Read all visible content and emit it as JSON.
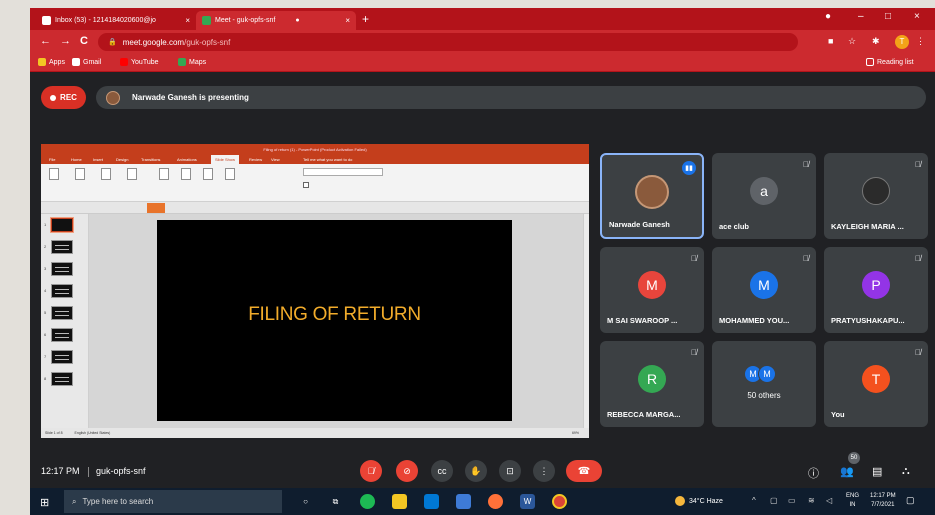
{
  "browser": {
    "tabs": [
      {
        "title": "Inbox (53) - 1214184020600@jo",
        "close": "×"
      },
      {
        "title": "Meet - guk-opfs-snf",
        "close": "×"
      }
    ],
    "new_tab": "+",
    "window_controls": {
      "minimize": "–",
      "maximize": "□",
      "close": "×"
    },
    "nav": {
      "back": "←",
      "forward": "→",
      "reload": "C"
    },
    "url_host": "meet.google.com",
    "url_path": "/guk-opfs-snf",
    "bookmarks": [
      {
        "label": "Apps",
        "color": "#f3c623"
      },
      {
        "label": "Gmail",
        "color": "#ffffff"
      },
      {
        "label": "YouTube",
        "color": "#ff0000"
      },
      {
        "label": "Maps",
        "color": "#34a853"
      }
    ],
    "reading_list": "Reading list",
    "profile_initial": "T"
  },
  "meeting": {
    "rec_label": "REC",
    "presenting_text": "Narwade Ganesh is presenting",
    "time": "12:17 PM",
    "code": "guk-opfs-snf",
    "people_count": "50"
  },
  "presentation": {
    "app_title": "Filing of return (1) - PowerPoint (Product Activation Failed)",
    "menu": [
      "File",
      "Home",
      "Insert",
      "Design",
      "Transitions",
      "Animations",
      "Slide Show",
      "Review",
      "View",
      "Tell me what you want to do"
    ],
    "slide_title": "FILING OF RETURN",
    "slide_count": "Slide 1 of 8",
    "status_language": "English (United States)",
    "zoom": "69%"
  },
  "participants": [
    {
      "name": "Narwade Ganesh",
      "initial": "",
      "color": "#8a5a3c",
      "speaking": true
    },
    {
      "name": "ace club",
      "initial": "a",
      "color": "#5f6368"
    },
    {
      "name": "KAYLEIGH MARIA ...",
      "initial": "",
      "color": "#2b2b2b"
    },
    {
      "name": "M SAI SWAROOP ...",
      "initial": "M",
      "color": "#e8453c"
    },
    {
      "name": "MOHAMMED YOU...",
      "initial": "M",
      "color": "#1a73e8"
    },
    {
      "name": "PRATYUSHAKAPU...",
      "initial": "P",
      "color": "#9334e6"
    },
    {
      "name": "REBECCA MARGA...",
      "initial": "R",
      "color": "#34a853"
    },
    {
      "name": "50 others",
      "initial": "M",
      "color": "#1a73e8"
    },
    {
      "name": "You",
      "initial": "T",
      "color": "#f4511e"
    }
  ],
  "taskbar": {
    "search_placeholder": "Type here to search",
    "weather": "34°C  Haze",
    "lang_1": "ENG",
    "lang_2": "IN",
    "clock_time": "12:17 PM",
    "clock_date": "7/7/2021"
  }
}
